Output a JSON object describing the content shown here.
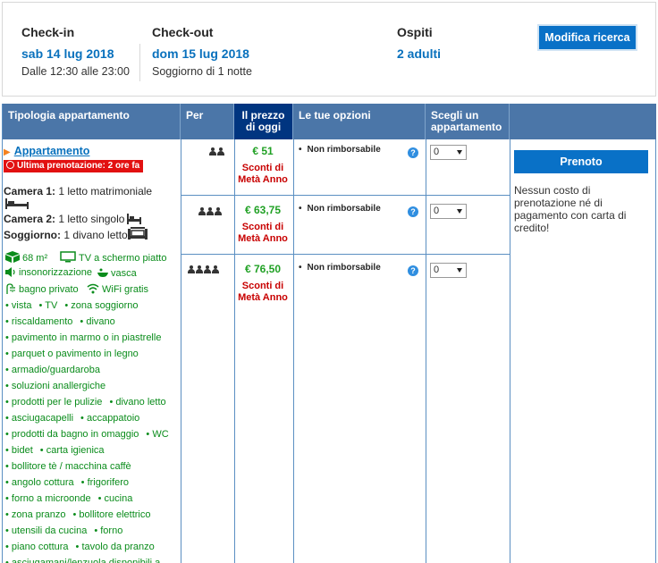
{
  "search": {
    "checkin_label": "Check-in",
    "checkin_date": "sab 14 lug 2018",
    "checkin_time": "Dalle 12:30 alle 23:00",
    "checkout_label": "Check-out",
    "checkout_date": "dom 15 lug 2018",
    "stay": "Soggiorno di 1 notte",
    "guests_label": "Ospiti",
    "guests_value": "2 adulti",
    "modify_button": "Modifica ricerca"
  },
  "table": {
    "headers": {
      "type": "Tipologia appartamento",
      "per": "Per",
      "price": "Il prezzo di oggi",
      "options": "Le tue opzioni",
      "choose": "Scegli un appartamento"
    },
    "room": {
      "name": "Appartamento",
      "urgency": "Ultima prenotazione: 2 ore fa",
      "beds": [
        {
          "label": "Camera 1:",
          "text": "1 letto matrimoniale"
        },
        {
          "label": "Camera 2:",
          "text": "1 letto singolo"
        },
        {
          "label": "Soggiorno:",
          "text": "1 divano letto"
        }
      ],
      "facilities": {
        "size": "68 m²",
        "tv": "TV a schermo piatto",
        "soundproof": "insonorizzazione",
        "bath": "vasca",
        "private_bath": "bagno privato",
        "wifi": "WiFi gratis",
        "list": [
          [
            "vista",
            "TV",
            "zona soggiorno"
          ],
          [
            "riscaldamento",
            "divano"
          ],
          [
            "pavimento in marmo o in piastrelle"
          ],
          [
            "parquet o pavimento in legno"
          ],
          [
            "armadio/guardaroba"
          ],
          [
            "soluzioni anallergiche"
          ],
          [
            "prodotti per le pulizie",
            "divano letto"
          ],
          [
            "asciugacapelli",
            "accappatoio"
          ],
          [
            "prodotti da bagno in omaggio",
            "WC"
          ],
          [
            "bidet",
            "carta igienica"
          ],
          [
            "bollitore tè / macchina caffè"
          ],
          [
            "angolo cottura",
            "frigorifero"
          ],
          [
            "forno a microonde",
            "cucina"
          ],
          [
            "zona pranzo",
            "bollitore elettrico"
          ],
          [
            "utensili da cucina",
            "forno"
          ],
          [
            "piano cottura",
            "tavolo da pranzo"
          ],
          [
            "asciugamani/lenzuola disponibili a"
          ]
        ]
      }
    },
    "rates": [
      {
        "persons": 2,
        "price": "€ 51",
        "discount": "Sconti di Metà Anno",
        "option": "Non rimborsabile",
        "qty": "0"
      },
      {
        "persons": 3,
        "price": "€ 63,75",
        "discount": "Sconti di Metà Anno",
        "option": "Non rimborsabile",
        "qty": "0"
      },
      {
        "persons": 4,
        "price": "€ 76,50",
        "discount": "Sconti di Metà Anno",
        "option": "Non rimborsabile",
        "qty": "0"
      }
    ],
    "book_button": "Prenoto",
    "book_note": "Nessun costo di prenotazione né di pagamento con carta di credito!"
  }
}
